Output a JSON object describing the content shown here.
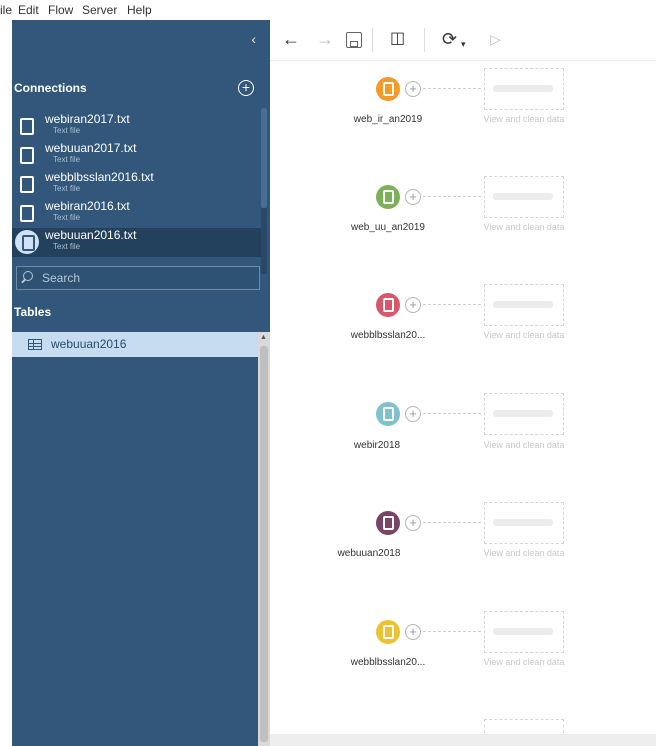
{
  "menu": [
    "ile",
    "Edit",
    "Flow",
    "Server",
    "Help"
  ],
  "sidebar": {
    "connections_title": "Connections",
    "connections": [
      {
        "name": "webiran2017.txt",
        "type": "Text file",
        "selected": false
      },
      {
        "name": "webuuan2017.txt",
        "type": "Text file",
        "selected": false
      },
      {
        "name": "webblbsslan2016.txt",
        "type": "Text file",
        "selected": false
      },
      {
        "name": "webiran2016.txt",
        "type": "Text file",
        "selected": false
      },
      {
        "name": "webuuan2016.txt",
        "type": "Text file",
        "selected": true
      }
    ],
    "search_placeholder": "Search",
    "tables_title": "Tables",
    "tables": [
      {
        "name": "webuuan2016",
        "selected": true
      }
    ]
  },
  "toolbar": {
    "icons": [
      "back-arrow-icon",
      "forward-arrow-icon",
      "save-icon",
      "pause-data-icon",
      "refresh-icon",
      "run-icon"
    ]
  },
  "flow": {
    "ghost_label": "View and clean data",
    "nodes": [
      {
        "label": "web_ir_an2019",
        "color": "#f39a2b"
      },
      {
        "label": "web_uu_an2019",
        "color": "#7cb15a"
      },
      {
        "label": "webblbsslan20...",
        "color": "#d9576b"
      },
      {
        "label": "webir2018",
        "color": "#7fc1cf"
      },
      {
        "label": "webuuan2018",
        "color": "#7a4466"
      },
      {
        "label": "webblbsslan20...",
        "color": "#ecc233"
      }
    ]
  }
}
